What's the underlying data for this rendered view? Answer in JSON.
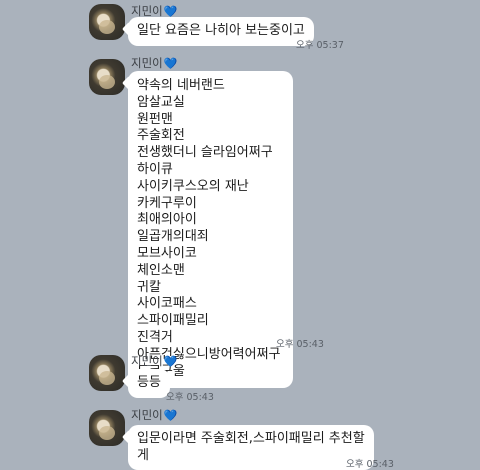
{
  "colors": {
    "background": "#aab2bc",
    "bubble": "#ffffff",
    "heart": "#2e8bff"
  },
  "messages": [
    {
      "sender": "지민이",
      "heart": "💙",
      "lines": [
        "일단 요즘은 나히아 보는중이고"
      ],
      "time": "오후 05:37"
    },
    {
      "sender": "지민이",
      "heart": "💙",
      "lines": [
        "약속의 네버랜드",
        "암살교실",
        "원펀맨",
        "주술회전",
        "전생했더니 슬라임어쩌구",
        "하이큐",
        "사이키쿠스오의 재난",
        "카케구루이",
        "최애의아이",
        "일곱개의대죄",
        "모브사이코",
        "체인소맨",
        "귀칼",
        "사이코패스",
        "스파이패밀리",
        "진격거",
        "아픈건싫으니방어력어쩌구",
        "도쿄구울"
      ],
      "time": "오후 05:43"
    },
    {
      "sender": "지민이",
      "heart": "💙",
      "lines": [
        "등등"
      ],
      "time": "오후 05:43"
    },
    {
      "sender": "지민이",
      "heart": "💙",
      "lines": [
        "입문이라면 주술회전,스파이패밀리 추천할",
        "게"
      ],
      "time": "오후 05:43"
    }
  ]
}
